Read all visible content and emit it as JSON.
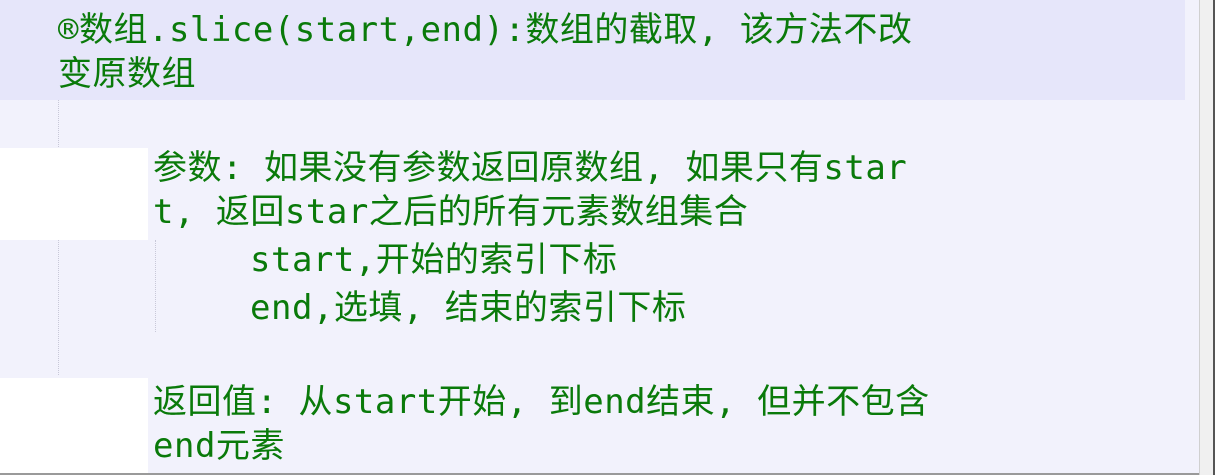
{
  "heading": {
    "line1": "®数组.slice(start,end):数组的截取, 该方法不改",
    "line2": "变原数组"
  },
  "params": {
    "line1": "参数: 如果没有参数返回原数组, 如果只有star",
    "line2": "t, 返回star之后的所有元素数组集合",
    "start_item": "start,开始的索引下标",
    "end_item": "end,选填, 结束的索引下标"
  },
  "returns": {
    "line1": "返回值: 从start开始, 到end结束, 但并不包含",
    "line2": "end元素"
  },
  "colors": {
    "text": "#0a7a0a",
    "header_bg": "#e6e6fa",
    "editor_bg": "#f2f2fc"
  }
}
